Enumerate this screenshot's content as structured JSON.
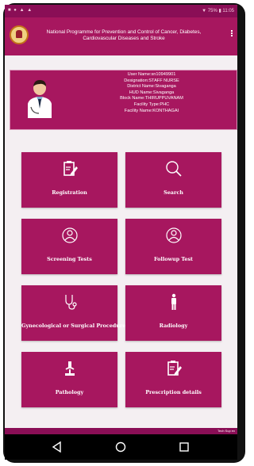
{
  "status_bar": {
    "left_icons": "■ ● ▲ ▲",
    "right_text": "▼ 75% ▮ 11:05"
  },
  "header": {
    "title": "National Programme for Prevention and Control of Cancer, Diabetes, Cardiovascular Diseases and Stroke"
  },
  "user": {
    "line1": "User Name:sn10949901",
    "line2": "Designation:STAFF NURSE",
    "line3": "District Name:Sivaganga",
    "line4": "HUD Name:Sivaganga",
    "line5": "Block Name:THIRUPPUVANAM",
    "line6": "Facility Type:PHC",
    "line7": "Facility Name:KONTHAGAI"
  },
  "tiles": [
    {
      "label": "Registration",
      "icon": "clipboard-pen-icon"
    },
    {
      "label": "Search",
      "icon": "search-icon"
    },
    {
      "label": "Screening Tests",
      "icon": "person-circle-icon"
    },
    {
      "label": "Followup Test",
      "icon": "person-circle-icon"
    },
    {
      "label": "Gynecological or Surgical Procedures",
      "icon": "stethoscope-icon"
    },
    {
      "label": "Radiology",
      "icon": "person-standing-icon"
    },
    {
      "label": "Pathology",
      "icon": "microscope-icon"
    },
    {
      "label": "Prescription details",
      "icon": "clipboard-pen-icon"
    }
  ],
  "bottom_strip_text": "Tech Sup ex",
  "colors": {
    "primary": "#a7175f",
    "status_bar": "#8a0e56",
    "background": "#f4eff2"
  }
}
